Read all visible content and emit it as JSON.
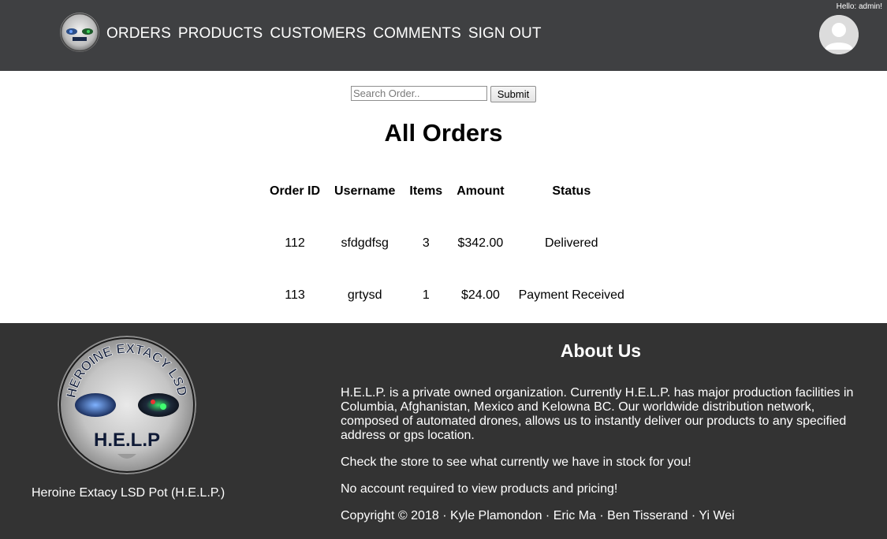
{
  "header": {
    "logo_text": "H.E.L.P",
    "nav": [
      "ORDERS",
      "PRODUCTS",
      "CUSTOMERS",
      "COMMENTS",
      "SIGN OUT"
    ],
    "greeting": "Hello: admin!"
  },
  "search": {
    "placeholder": "Search Order..",
    "submit_label": "Submit"
  },
  "page_title": "All Orders",
  "orders": {
    "columns": [
      "Order ID",
      "Username",
      "Items",
      "Amount",
      "Status"
    ],
    "rows": [
      [
        "112",
        "sfdgdfsg",
        "3",
        "$342.00",
        "Delivered"
      ],
      [
        "113",
        "grtysd",
        "1",
        "$24.00",
        "Payment Received"
      ]
    ]
  },
  "footer": {
    "logo_ring_text": "HEROINE EXTACY LSD POT",
    "logo_text": "H.E.L.P",
    "org_name": "Heroine Extacy LSD Pot (H.E.L.P.)",
    "about_title": "About Us",
    "paragraphs": [
      "H.E.L.P. is a private owned organization. Currently H.E.L.P. has major production facilities in Columbia, Afghanistan, Mexico and Kelowna BC. Our worldwide distribution network, composed of automated drones, allows us to instantly deliver our products to any specified address or gps location.",
      "Check the store to see what currently we have in stock for you!",
      "No account required to view products and pricing!"
    ],
    "copyright": "Copyright © 2018 · Kyle Plamondon · Eric Ma · Ben Tisserand · Yi Wei"
  },
  "colors": {
    "header_bg": "#3f4042",
    "footer_bg": "#333333",
    "text_light": "#ffffff"
  }
}
